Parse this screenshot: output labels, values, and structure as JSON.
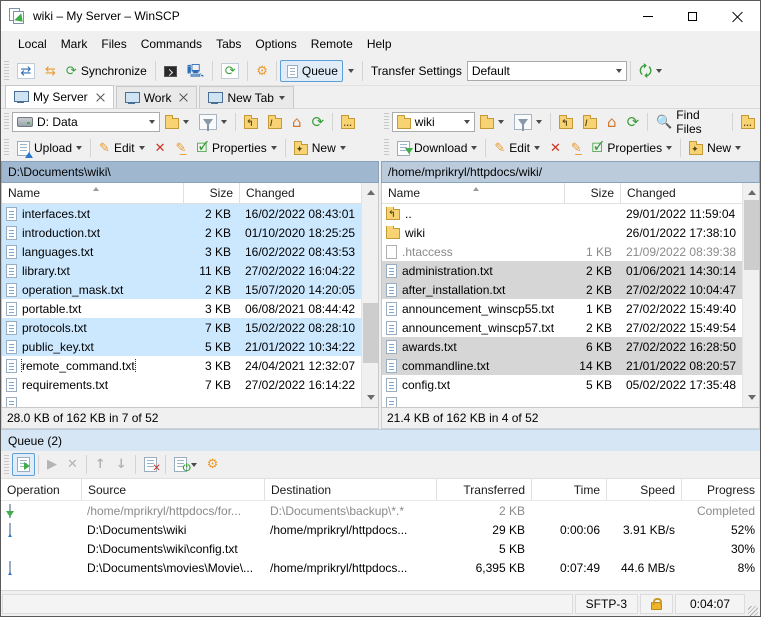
{
  "window": {
    "title": "wiki – My Server – WinSCP"
  },
  "menu": {
    "items": [
      "Local",
      "Mark",
      "Files",
      "Commands",
      "Tabs",
      "Options",
      "Remote",
      "Help"
    ]
  },
  "toolbar": {
    "synchronize_label": "Synchronize",
    "queue_label": "Queue",
    "transfer_settings_label": "Transfer Settings",
    "transfer_settings_value": "Default"
  },
  "session_tabs": [
    {
      "label": "My Server",
      "active": true,
      "closable": true
    },
    {
      "label": "Work",
      "active": false,
      "closable": true
    },
    {
      "label": "New Tab",
      "active": false,
      "closable": false
    }
  ],
  "left_panel": {
    "drive_value": "D: Data",
    "upload_label": "Upload",
    "edit_label": "Edit",
    "properties_label": "Properties",
    "new_label": "New",
    "path": "D:\\Documents\\wiki\\",
    "columns": {
      "name": "Name",
      "size": "Size",
      "changed": "Changed"
    },
    "files": [
      {
        "icon": "file-text",
        "name": "interfaces.txt",
        "size": "2 KB",
        "changed": "16/02/2022 08:43:01",
        "selected": true
      },
      {
        "icon": "file-text",
        "name": "introduction.txt",
        "size": "2 KB",
        "changed": "01/10/2020 18:25:25",
        "selected": true
      },
      {
        "icon": "file-text",
        "name": "languages.txt",
        "size": "3 KB",
        "changed": "16/02/2022 08:43:53",
        "selected": true
      },
      {
        "icon": "file-text",
        "name": "library.txt",
        "size": "11 KB",
        "changed": "27/02/2022 16:04:22",
        "selected": true
      },
      {
        "icon": "file-text",
        "name": "operation_mask.txt",
        "size": "2 KB",
        "changed": "15/07/2020 14:20:05",
        "selected": true
      },
      {
        "icon": "file-text",
        "name": "portable.txt",
        "size": "3 KB",
        "changed": "06/08/2021 08:44:42",
        "selected": false
      },
      {
        "icon": "file-text",
        "name": "protocols.txt",
        "size": "7 KB",
        "changed": "15/02/2022 08:28:10",
        "selected": true
      },
      {
        "icon": "file-text",
        "name": "public_key.txt",
        "size": "5 KB",
        "changed": "21/01/2022 10:34:22",
        "selected": true
      },
      {
        "icon": "file-text",
        "name": "remote_command.txt",
        "size": "3 KB",
        "changed": "24/04/2021 12:32:07",
        "selected": false,
        "focused": true
      },
      {
        "icon": "file-text",
        "name": "requirements.txt",
        "size": "7 KB",
        "changed": "27/02/2022 16:14:22",
        "selected": false
      }
    ],
    "status": "28.0 KB of 162 KB in 7 of 52"
  },
  "right_panel": {
    "dir_value": "wiki",
    "find_files_label": "Find Files",
    "download_label": "Download",
    "edit_label": "Edit",
    "properties_label": "Properties",
    "new_label": "New",
    "path": "/home/mprikryl/httpdocs/wiki/",
    "columns": {
      "name": "Name",
      "size": "Size",
      "changed": "Changed"
    },
    "files": [
      {
        "icon": "folder-up",
        "name": "..",
        "size": "",
        "changed": "29/01/2022 11:59:04",
        "selected": false
      },
      {
        "icon": "folder",
        "name": "wiki",
        "size": "",
        "changed": "26/01/2022 17:38:10",
        "selected": false
      },
      {
        "icon": "file-plain",
        "name": ".htaccess",
        "size": "1 KB",
        "changed": "21/09/2022 08:39:38",
        "selected": false,
        "dimmed": true
      },
      {
        "icon": "file-text",
        "name": "administration.txt",
        "size": "2 KB",
        "changed": "01/06/2021 14:30:14",
        "selected": true
      },
      {
        "icon": "file-text",
        "name": "after_installation.txt",
        "size": "2 KB",
        "changed": "27/02/2022 10:04:47",
        "selected": true
      },
      {
        "icon": "file-text",
        "name": "announcement_winscp55.txt",
        "size": "1 KB",
        "changed": "27/02/2022 15:49:40",
        "selected": false
      },
      {
        "icon": "file-text",
        "name": "announcement_winscp57.txt",
        "size": "2 KB",
        "changed": "27/02/2022 15:49:54",
        "selected": false
      },
      {
        "icon": "file-text",
        "name": "awards.txt",
        "size": "6 KB",
        "changed": "27/02/2022 16:28:50",
        "selected": true
      },
      {
        "icon": "file-text",
        "name": "commandline.txt",
        "size": "14 KB",
        "changed": "21/01/2022 08:20:57",
        "selected": true
      },
      {
        "icon": "file-text",
        "name": "config.txt",
        "size": "5 KB",
        "changed": "05/02/2022 17:35:48",
        "selected": false
      }
    ],
    "status": "21.4 KB of 162 KB in 4 of 52"
  },
  "queue": {
    "title": "Queue (2)",
    "columns": [
      "Operation",
      "Source",
      "Destination",
      "Transferred",
      "Time",
      "Speed",
      "Progress"
    ],
    "items": [
      {
        "op_icon": "download-operation-icon",
        "source": "/home/mprikryl/httpdocs/for...",
        "destination": "D:\\Documents\\backup\\*.*",
        "transferred": "2 KB",
        "time": "",
        "speed": "",
        "progress": "Completed",
        "dimmed": true
      },
      {
        "op_icon": "upload-operation-icon",
        "source": "D:\\Documents\\wiki",
        "destination": "/home/mprikryl/httpdocs...",
        "transferred": "29 KB",
        "time": "0:00:06",
        "speed": "3.91 KB/s",
        "progress": "52%",
        "dimmed": false
      },
      {
        "op_icon": "",
        "source": "D:\\Documents\\wiki\\config.txt",
        "destination": "",
        "transferred": "5 KB",
        "time": "",
        "speed": "",
        "progress": "30%",
        "dimmed": false
      },
      {
        "op_icon": "upload-operation-icon",
        "source": "D:\\Documents\\movies\\Movie\\...",
        "destination": "/home/mprikryl/httpdocs...",
        "transferred": "6,395 KB",
        "time": "0:07:49",
        "speed": "44.6 MB/s",
        "progress": "8%",
        "dimmed": false
      }
    ]
  },
  "status_bar": {
    "protocol": "SFTP-3",
    "duration": "0:04:07"
  }
}
